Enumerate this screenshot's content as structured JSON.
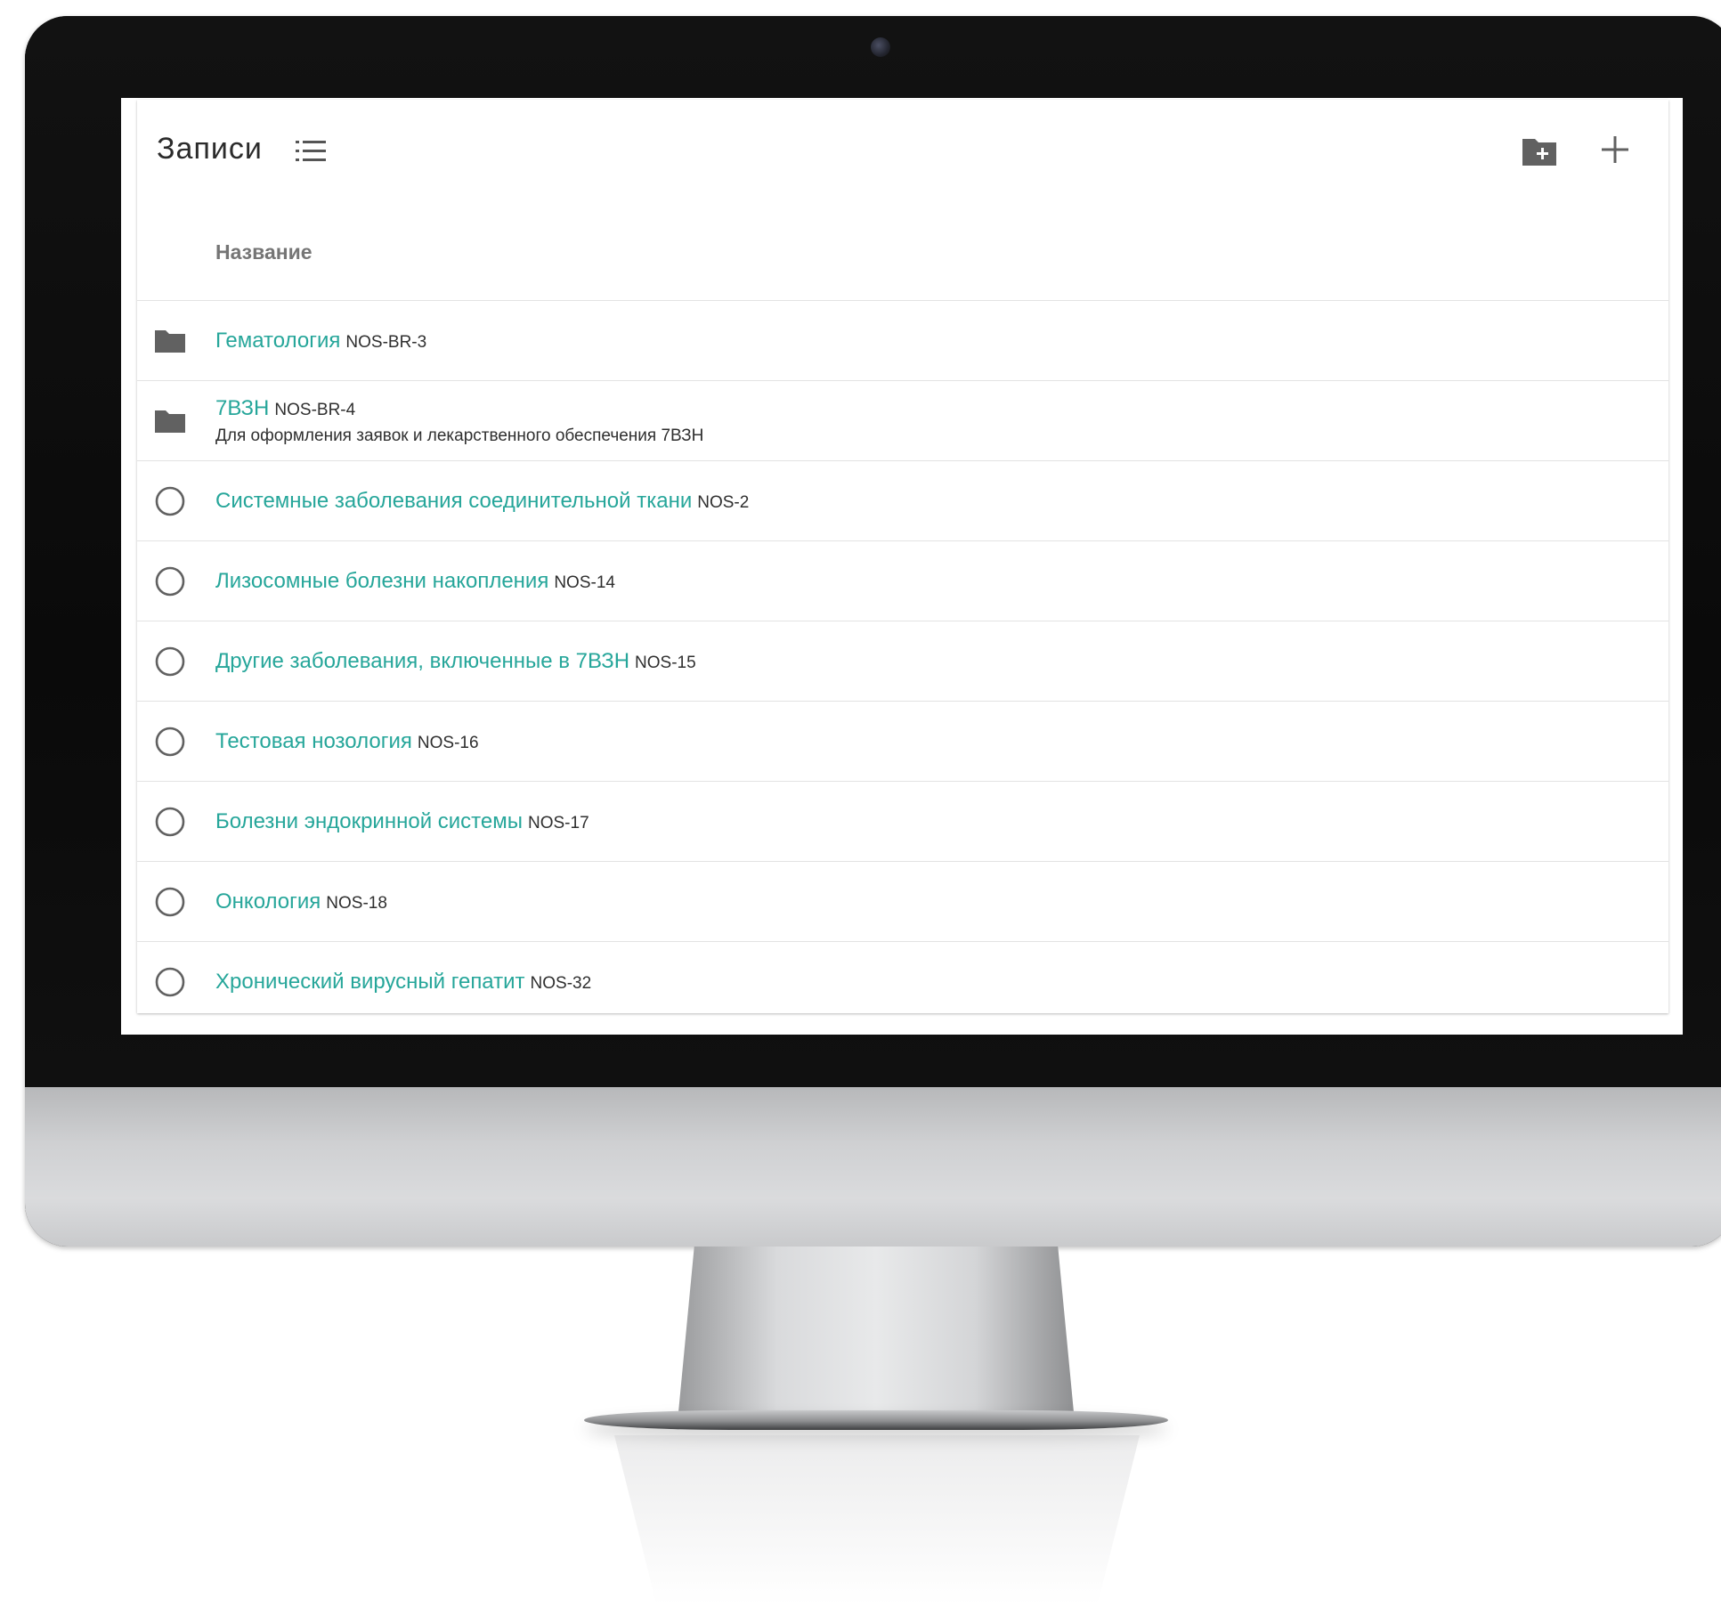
{
  "header": {
    "title": "Записи",
    "list_view_icon": "list-icon",
    "folder_add_icon": "folder-add-icon",
    "add_icon": "plus-icon"
  },
  "table": {
    "column_name": "Название",
    "rows": [
      {
        "type": "folder",
        "icon": "folder-icon",
        "name": "Гематология",
        "code": "NOS-BR-3",
        "description": ""
      },
      {
        "type": "folder",
        "icon": "folder-icon",
        "name": "7ВЗН",
        "code": "NOS-BR-4",
        "description": "Для оформления заявок и лекарственного обеспечения 7ВЗН"
      },
      {
        "type": "item",
        "icon": "radio-circle-icon",
        "name": "Системные заболевания соединительной ткани",
        "code": "NOS-2",
        "description": ""
      },
      {
        "type": "item",
        "icon": "radio-circle-icon",
        "name": "Лизосомные болезни накопления",
        "code": "NOS-14",
        "description": ""
      },
      {
        "type": "item",
        "icon": "radio-circle-icon",
        "name": "Другие заболевания, включенные в 7ВЗН",
        "code": "NOS-15",
        "description": ""
      },
      {
        "type": "item",
        "icon": "radio-circle-icon",
        "name": "Тестовая нозология",
        "code": "NOS-16",
        "description": ""
      },
      {
        "type": "item",
        "icon": "radio-circle-icon",
        "name": "Болезни эндокринной системы",
        "code": "NOS-17",
        "description": ""
      },
      {
        "type": "item",
        "icon": "radio-circle-icon",
        "name": "Онкология",
        "code": "NOS-18",
        "description": ""
      },
      {
        "type": "item",
        "icon": "radio-circle-icon",
        "name": "Хронический вирусный гепатит",
        "code": "NOS-32",
        "description": ""
      }
    ]
  },
  "colors": {
    "link": "#26a69a",
    "icon": "#616161"
  }
}
